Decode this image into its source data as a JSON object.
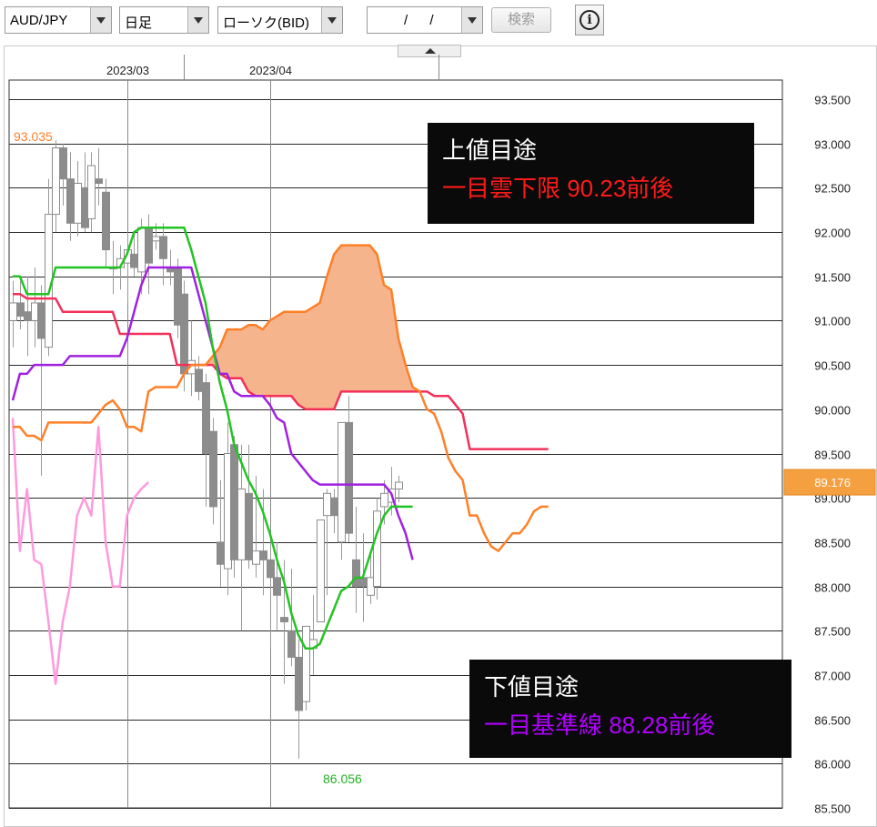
{
  "toolbar": {
    "pair": "AUD/JPY",
    "period": "日足",
    "chart_kind": "ローソク(BID)",
    "date": "/ /",
    "search_label": "検索",
    "info_glyph": "i"
  },
  "colors": {
    "kijun": "#a020e0",
    "tenkan": "#22c322",
    "span_a": "#ff7f27",
    "span_b": "#f2305a",
    "chikou": "#ff99dd",
    "cloud": "#f5b48c",
    "price_tag": "#f5a040",
    "up_target": "#ff1a1a",
    "down_target": "#b000ff"
  },
  "annotations": {
    "high_label": "93.035",
    "low_label": "86.056",
    "current_price": "89.176",
    "upper_title": "上値目途",
    "upper_text": "一目雲下限 90.23前後",
    "lower_title": "下値目途",
    "lower_text": "一目基準線 88.28前後"
  },
  "chart_data": {
    "type": "candlestick",
    "ylim": [
      85.4,
      93.85
    ],
    "yticks": [
      "85.500",
      "86.000",
      "86.500",
      "87.000",
      "87.500",
      "88.000",
      "88.500",
      "89.000",
      "89.500",
      "90.000",
      "90.500",
      "91.000",
      "91.500",
      "92.000",
      "92.500",
      "93.000",
      "93.500"
    ],
    "xticks": [
      {
        "label": "2023/03",
        "index": 16
      },
      {
        "label": "2023/04",
        "index": 36
      }
    ],
    "candles": [
      [
        91.0,
        91.45,
        90.7,
        91.2
      ],
      [
        91.2,
        91.45,
        90.9,
        91.05
      ],
      [
        91.1,
        91.5,
        90.6,
        91.0
      ],
      [
        91.0,
        91.6,
        90.7,
        91.2
      ],
      [
        91.2,
        91.4,
        89.25,
        90.8
      ],
      [
        90.7,
        92.6,
        90.6,
        92.2
      ],
      [
        92.2,
        93.035,
        92.0,
        92.95
      ],
      [
        92.95,
        93.0,
        92.3,
        92.6
      ],
      [
        92.6,
        92.9,
        91.9,
        92.1
      ],
      [
        92.1,
        92.8,
        91.95,
        92.55
      ],
      [
        92.5,
        92.9,
        92.0,
        92.05
      ],
      [
        92.15,
        92.9,
        92.0,
        92.75
      ],
      [
        92.6,
        92.95,
        92.3,
        92.55
      ],
      [
        92.45,
        92.6,
        91.6,
        91.8
      ],
      [
        91.6,
        91.9,
        91.3,
        91.6
      ],
      [
        91.6,
        91.85,
        91.35,
        91.7
      ],
      [
        91.65,
        92.0,
        91.2,
        91.8
      ],
      [
        91.75,
        92.0,
        91.5,
        91.6
      ],
      [
        91.55,
        92.15,
        91.3,
        92.05
      ],
      [
        92.05,
        92.2,
        91.3,
        91.65
      ],
      [
        91.9,
        92.1,
        91.8,
        91.95
      ],
      [
        91.95,
        92.1,
        91.4,
        91.7
      ],
      [
        91.6,
        91.8,
        91.4,
        91.55
      ],
      [
        91.6,
        91.7,
        90.8,
        90.95
      ],
      [
        91.3,
        91.45,
        90.2,
        90.4
      ],
      [
        90.4,
        91.0,
        90.15,
        90.55
      ],
      [
        90.45,
        90.6,
        90.1,
        90.2
      ],
      [
        90.3,
        90.4,
        88.9,
        89.5
      ],
      [
        89.75,
        89.9,
        88.7,
        88.9
      ],
      [
        88.5,
        89.2,
        88.0,
        88.25
      ],
      [
        88.2,
        89.85,
        87.9,
        89.5
      ],
      [
        89.6,
        89.7,
        88.1,
        88.3
      ],
      [
        88.3,
        89.6,
        87.5,
        89.1
      ],
      [
        89.05,
        89.6,
        88.2,
        88.3
      ],
      [
        88.25,
        89.25,
        88.1,
        88.4
      ],
      [
        88.4,
        89.1,
        87.9,
        88.3
      ],
      [
        88.3,
        88.6,
        87.3,
        88.1
      ],
      [
        88.1,
        88.5,
        87.5,
        87.9
      ],
      [
        87.65,
        88.3,
        86.9,
        87.6
      ],
      [
        87.5,
        88.2,
        87.1,
        87.2
      ],
      [
        87.2,
        87.4,
        86.056,
        86.6
      ],
      [
        86.7,
        87.5,
        86.6,
        87.55
      ],
      [
        87.3,
        87.9,
        87.0,
        87.4
      ],
      [
        87.6,
        88.7,
        87.6,
        88.75
      ],
      [
        88.8,
        89.1,
        87.9,
        89.05
      ],
      [
        89.0,
        89.1,
        88.6,
        88.8
      ],
      [
        88.5,
        89.8,
        88.3,
        89.85
      ],
      [
        89.85,
        90.15,
        88.5,
        88.6
      ],
      [
        88.3,
        88.9,
        87.7,
        88.0
      ],
      [
        88.1,
        88.6,
        87.6,
        88.0
      ],
      [
        87.9,
        88.4,
        87.8,
        88.1
      ],
      [
        88.0,
        89.0,
        87.85,
        88.85
      ],
      [
        88.9,
        89.2,
        88.7,
        89.05
      ],
      [
        88.95,
        89.35,
        88.8,
        89.1
      ],
      [
        89.1,
        89.25,
        88.95,
        89.176
      ]
    ],
    "series": [
      {
        "key": "tenkan",
        "start": 0,
        "values": [
          91.5,
          91.5,
          91.3,
          91.3,
          91.3,
          91.3,
          91.6,
          91.6,
          91.6,
          91.6,
          91.6,
          91.6,
          91.6,
          91.6,
          91.6,
          91.6,
          91.75,
          92.0,
          92.05,
          92.05,
          92.05,
          92.05,
          92.05,
          92.05,
          92.05,
          91.8,
          91.5,
          91.2,
          90.7,
          90.3,
          90.0,
          89.6,
          89.4,
          89.2,
          89.05,
          88.85,
          88.6,
          88.3,
          88.05,
          87.7,
          87.45,
          87.3,
          87.3,
          87.35,
          87.55,
          87.75,
          87.95,
          88.0,
          88.1,
          88.1,
          88.35,
          88.6,
          88.8,
          88.9,
          88.9,
          88.9,
          88.9
        ]
      },
      {
        "key": "kijun",
        "start": 0,
        "values": [
          90.1,
          90.4,
          90.4,
          90.5,
          90.5,
          90.5,
          90.5,
          90.5,
          90.6,
          90.6,
          90.6,
          90.6,
          90.6,
          90.6,
          90.6,
          90.6,
          90.8,
          91.1,
          91.4,
          91.6,
          91.6,
          91.6,
          91.6,
          91.6,
          91.6,
          91.6,
          91.3,
          91.0,
          90.7,
          90.4,
          90.4,
          90.2,
          90.15,
          90.15,
          90.15,
          90.15,
          90.05,
          89.9,
          89.85,
          89.5,
          89.4,
          89.3,
          89.2,
          89.15,
          89.15,
          89.15,
          89.15,
          89.15,
          89.15,
          89.15,
          89.15,
          89.15,
          89.15,
          89.05,
          88.8,
          88.6,
          88.3
        ]
      },
      {
        "key": "span_a",
        "start": 0,
        "values": [
          89.8,
          89.8,
          89.7,
          89.7,
          89.65,
          89.85,
          89.85,
          89.85,
          89.85,
          89.85,
          89.85,
          89.85,
          89.95,
          90.05,
          90.1,
          90.0,
          89.8,
          89.8,
          89.75,
          90.2,
          90.25,
          90.25,
          90.25,
          90.25,
          90.4,
          90.5,
          90.5,
          90.5,
          90.6,
          90.7,
          90.9,
          90.9,
          90.9,
          90.95,
          90.95,
          90.9,
          91.0,
          91.05,
          91.1,
          91.1,
          91.1,
          91.1,
          91.15,
          91.2,
          91.5,
          91.75,
          91.85,
          91.85,
          91.85,
          91.85,
          91.85,
          91.75,
          91.4,
          91.35,
          90.8,
          90.5,
          90.25,
          90.2,
          90.0,
          89.95,
          89.75,
          89.45,
          89.3,
          89.2,
          88.8,
          88.8,
          88.6,
          88.45,
          88.4,
          88.5,
          88.6,
          88.6,
          88.7,
          88.85,
          88.9,
          88.9
        ]
      },
      {
        "key": "span_b",
        "start": 0,
        "values": [
          91.3,
          91.3,
          91.25,
          91.25,
          91.25,
          91.25,
          91.25,
          91.1,
          91.1,
          91.1,
          91.1,
          91.1,
          91.1,
          91.1,
          91.1,
          90.85,
          90.85,
          90.85,
          90.85,
          90.85,
          90.85,
          90.85,
          90.85,
          90.5,
          90.5,
          90.5,
          90.5,
          90.5,
          90.5,
          90.4,
          90.35,
          90.35,
          90.35,
          90.2,
          90.15,
          90.15,
          90.15,
          90.15,
          90.15,
          90.15,
          90.05,
          90.0,
          90.0,
          90.0,
          90.0,
          90.0,
          90.2,
          90.2,
          90.2,
          90.2,
          90.2,
          90.2,
          90.2,
          90.2,
          90.2,
          90.2,
          90.2,
          90.2,
          90.2,
          90.15,
          90.15,
          90.15,
          90.05,
          89.95,
          89.55,
          89.55,
          89.55,
          89.55,
          89.55,
          89.55,
          89.55,
          89.55,
          89.55,
          89.55,
          89.55,
          89.55
        ]
      },
      {
        "key": "chikou",
        "start": 0,
        "values": [
          89.9,
          88.4,
          89.1,
          88.3,
          88.25,
          87.6,
          86.9,
          87.6,
          88.0,
          88.8,
          89.0,
          88.8,
          89.8,
          88.5,
          88.0,
          88.0,
          88.8,
          89.0,
          89.1,
          89.176
        ]
      }
    ]
  }
}
